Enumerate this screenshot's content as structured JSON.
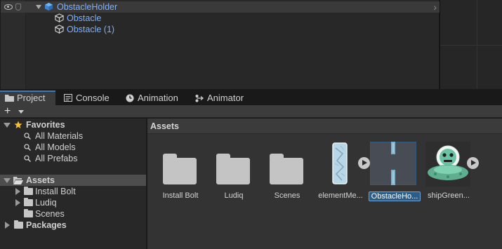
{
  "hierarchy": {
    "root": {
      "label": "ObstacleHolder",
      "expanded": true
    },
    "children": [
      {
        "label": "Obstacle"
      },
      {
        "label": "Obstacle (1)"
      }
    ],
    "text_color": "#7cb0ff"
  },
  "tabs": [
    {
      "label": "Project",
      "icon": "folder-icon",
      "active": true
    },
    {
      "label": "Console",
      "icon": "console-icon",
      "active": false
    },
    {
      "label": "Animation",
      "icon": "clock-icon",
      "active": false
    },
    {
      "label": "Animator",
      "icon": "animator-icon",
      "active": false
    }
  ],
  "toolbar": {
    "create_label": "+"
  },
  "tree": {
    "favorites": {
      "label": "Favorites",
      "items": [
        "All Materials",
        "All Models",
        "All Prefabs"
      ]
    },
    "assets": {
      "label": "Assets",
      "items": [
        "Install Bolt",
        "Ludiq",
        "Scenes"
      ]
    },
    "packages": {
      "label": "Packages"
    }
  },
  "assets_panel": {
    "breadcrumb": "Assets",
    "items": [
      {
        "label": "Install Bolt",
        "kind": "folder"
      },
      {
        "label": "Ludiq",
        "kind": "folder"
      },
      {
        "label": "Scenes",
        "kind": "folder"
      },
      {
        "label": "elementMe...",
        "kind": "sprite"
      },
      {
        "label": "ObstacleHo...",
        "kind": "prefab",
        "selected": true
      },
      {
        "label": "shipGreen...",
        "kind": "sprite"
      }
    ]
  },
  "colors": {
    "accent": "#3a79bb",
    "selection": "#2c5d87",
    "panel": "#282828"
  }
}
